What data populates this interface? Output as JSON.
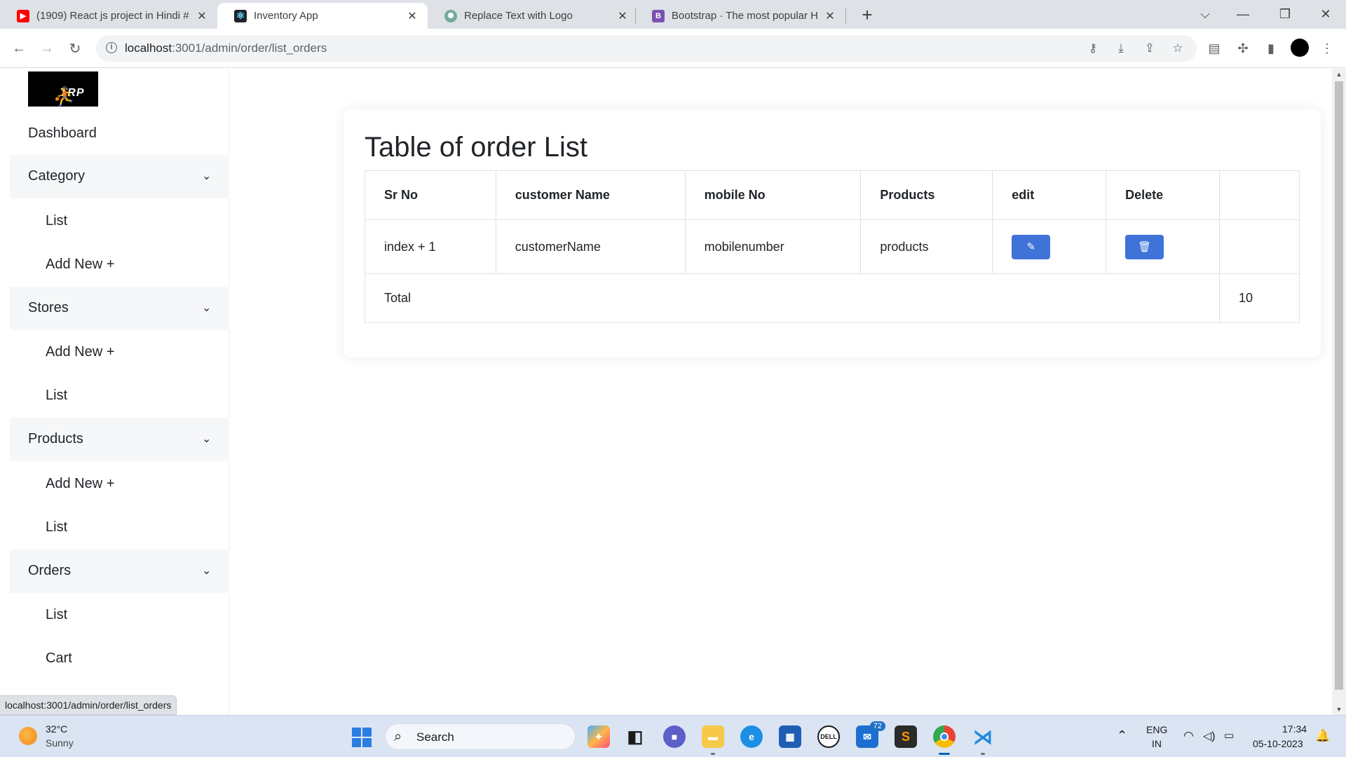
{
  "browser": {
    "tabs": [
      {
        "title": "(1909) React js project in Hindi #",
        "favicon": "youtube-icon",
        "active": false
      },
      {
        "title": "Inventory App",
        "favicon": "react-icon",
        "active": true
      },
      {
        "title": "Replace Text with Logo",
        "favicon": "chatgpt-icon",
        "active": false
      },
      {
        "title": "Bootstrap · The most popular HT",
        "favicon": "bootstrap-icon",
        "active": false
      }
    ],
    "url_host": "localhost",
    "url_path": ":3001/admin/order/list_orders",
    "status_url": "localhost:3001/admin/order/list_orders"
  },
  "sidebar": {
    "logo_text": "TRP",
    "dashboard": "Dashboard",
    "groups": [
      {
        "label": "Category",
        "items": [
          "List",
          "Add New +"
        ]
      },
      {
        "label": "Stores",
        "items": [
          "Add New +",
          "List"
        ]
      },
      {
        "label": "Products",
        "items": [
          "Add New +",
          "List"
        ]
      },
      {
        "label": "Orders",
        "items": [
          "List",
          "Cart"
        ]
      }
    ]
  },
  "main": {
    "title": "Table of order List",
    "columns": [
      "Sr No",
      "customer Name",
      "mobile No",
      "Products",
      "edit",
      "Delete",
      ""
    ],
    "row": {
      "sr": "index + 1",
      "customer": "customerName",
      "mobile": "mobilenumber",
      "products": "products"
    },
    "total_label": "Total",
    "total_value": "10",
    "colors": {
      "button": "#3f73d8"
    }
  },
  "taskbar": {
    "temperature": "32°C",
    "weather": "Sunny",
    "search_placeholder": "Search",
    "badge_count": "72",
    "lang_top": "ENG",
    "lang_bottom": "IN",
    "time": "17:34",
    "date": "05-10-2023"
  }
}
